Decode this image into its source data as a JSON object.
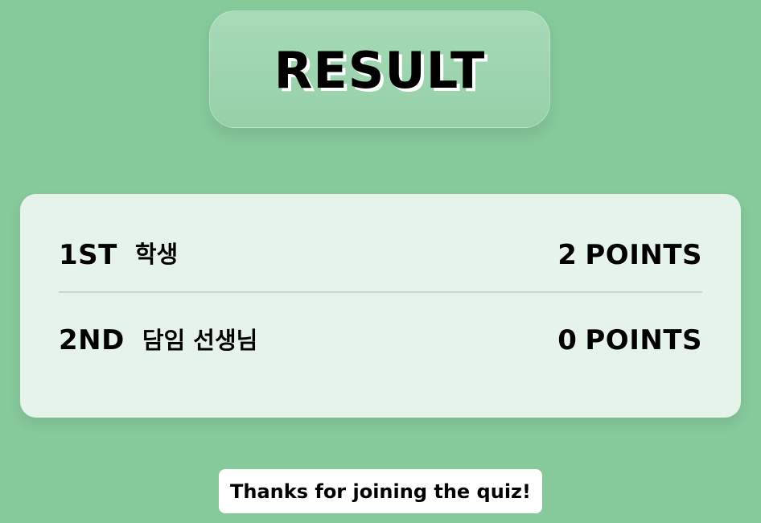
{
  "title": "RESULT",
  "results": [
    {
      "rank": "1ST",
      "name": "학생",
      "points_value": "2",
      "points_label": "POINTS"
    },
    {
      "rank": "2ND",
      "name": "담임 선생님",
      "points_value": "0",
      "points_label": "POINTS"
    }
  ],
  "footer": {
    "message": "Thanks for joining the quiz!"
  }
}
